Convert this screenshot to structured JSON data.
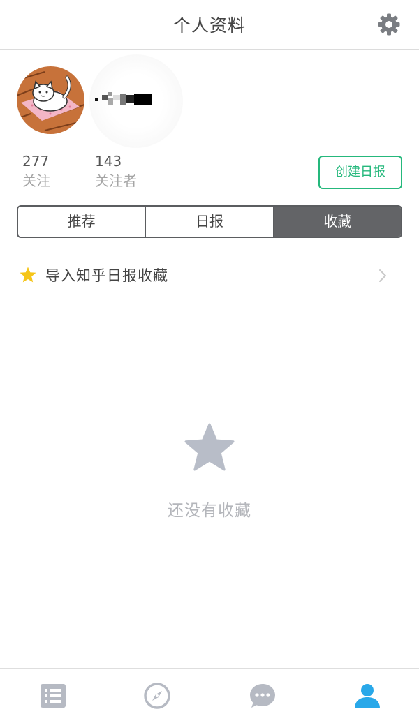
{
  "header": {
    "title": "个人资料",
    "settings_icon": "gear-icon"
  },
  "profile": {
    "avatar_icon": "cat-avatar",
    "username": "▪▪▪▪▪▪",
    "stats": [
      {
        "count": "277",
        "label": "关注"
      },
      {
        "count": "143",
        "label": "关注者"
      }
    ],
    "create_button": "创建日报"
  },
  "tabs": [
    {
      "label": "推荐",
      "active": false
    },
    {
      "label": "日报",
      "active": false
    },
    {
      "label": "收藏",
      "active": true
    }
  ],
  "import_row": {
    "icon": "star-icon",
    "label": "导入知乎日报收藏",
    "chevron": "chevron-right-icon"
  },
  "empty_state": {
    "icon": "star-icon",
    "text": "还没有收藏"
  },
  "bottom_nav": [
    {
      "icon": "list-icon",
      "active": false
    },
    {
      "icon": "compass-icon",
      "active": false
    },
    {
      "icon": "chat-bubble-icon",
      "active": false
    },
    {
      "icon": "person-icon",
      "active": true
    }
  ],
  "colors": {
    "accent_green": "#25b87c",
    "tab_active": "#636467",
    "nav_active": "#29a8e9",
    "nav_inactive": "#b6bac3",
    "star_yellow": "#f5c518",
    "empty_star": "#b8bdc8"
  }
}
